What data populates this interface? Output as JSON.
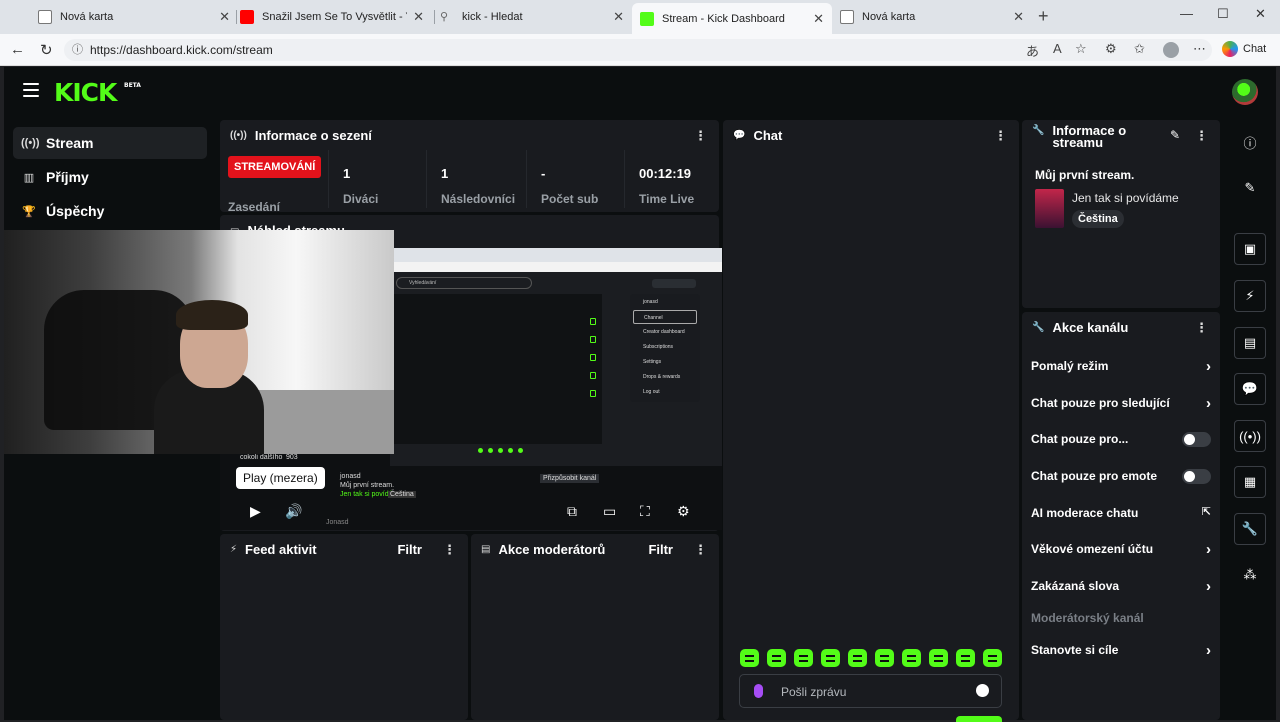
{
  "browser": {
    "tabs": [
      {
        "title": "Nová karta",
        "favicon_color": "#ffffff"
      },
      {
        "title": "Snažil Jsem Se To Vysvětlit - YouTu",
        "favicon_color": "#ff0000"
      },
      {
        "title": "kick - Hledat",
        "favicon_color": "#9aa0a6"
      },
      {
        "title": "Stream - Kick Dashboard",
        "favicon_color": "#53fc18"
      },
      {
        "title": "Nová karta",
        "favicon_color": "#ffffff"
      }
    ],
    "url": "https://dashboard.kick.com/stream",
    "chat_button": "Chat"
  },
  "app": {
    "logo": "KICK",
    "logo_sup": "BETA",
    "accent_color": "#53fc18",
    "nav": [
      {
        "label": "Stream",
        "icon": "broadcast-icon"
      },
      {
        "label": "Příjmy",
        "icon": "chart-icon"
      },
      {
        "label": "Úspěchy",
        "icon": "trophy-icon"
      }
    ]
  },
  "session": {
    "title": "Informace o sezení",
    "live_badge": "STREAMOVÁNÍ",
    "session_label": "Zasedání",
    "stats": [
      {
        "value": "1",
        "label": "Diváci"
      },
      {
        "value": "1",
        "label": "Následovníci"
      },
      {
        "value": "-",
        "label": "Počet sub"
      },
      {
        "value": "00:12:19",
        "label": "Time Live"
      }
    ]
  },
  "preview": {
    "title": "Náhled streamu",
    "tooltip": "Play (mezera)",
    "mini_menu": [
      "jonasd",
      "Channel",
      "Creator dashboard",
      "Subscriptions",
      "Settings",
      "Drops & rewards",
      "Log out"
    ],
    "mini_search": "Vyhledávání",
    "mini_channel": "jonasd",
    "mini_stream": "Můj první stream.",
    "mini_cat": "Jen tak si povídáme",
    "mini_lang": "Čeština",
    "mini_customize": "Přizpůsobit kanál",
    "mini_chat_user": "cokoli dalšího",
    "mini_viewers": "903",
    "mini_login_user": "Jonasd"
  },
  "feed": {
    "title": "Feed aktivit",
    "filter": "Filtr"
  },
  "modactions": {
    "title": "Akce moderátorů",
    "filter": "Filtr"
  },
  "chat": {
    "title": "Chat",
    "placeholder": "Pošli zprávu",
    "emote_count": 10
  },
  "stream_info": {
    "title": "Informace o streamu",
    "stream_title": "Můj první stream.",
    "category": "Jen tak si povídáme",
    "language": "Čeština"
  },
  "channel_actions": {
    "title": "Akce kanálu",
    "rows": [
      {
        "label": "Pomalý režim",
        "kind": "chevron"
      },
      {
        "label": "Chat pouze pro sledující",
        "kind": "chevron"
      },
      {
        "label": "Chat pouze pro...",
        "kind": "toggle"
      },
      {
        "label": "Chat pouze pro emote",
        "kind": "toggle"
      },
      {
        "label": "AI moderace chatu",
        "kind": "external"
      },
      {
        "label": "Věkové omezení účtu",
        "kind": "chevron"
      },
      {
        "label": "Zakázaná slova",
        "kind": "chevron"
      },
      {
        "label": "Moderátorský kanál",
        "kind": "muted"
      },
      {
        "label": "Stanovte si cíle",
        "kind": "chevron"
      }
    ]
  },
  "right_toolbar": [
    "info-icon",
    "edit-icon",
    "screen-icon",
    "lightning-icon",
    "notes-icon",
    "chat-bubble-icon",
    "broadcast-icon",
    "layout-icon",
    "wrench-icon",
    "nodes-icon"
  ]
}
